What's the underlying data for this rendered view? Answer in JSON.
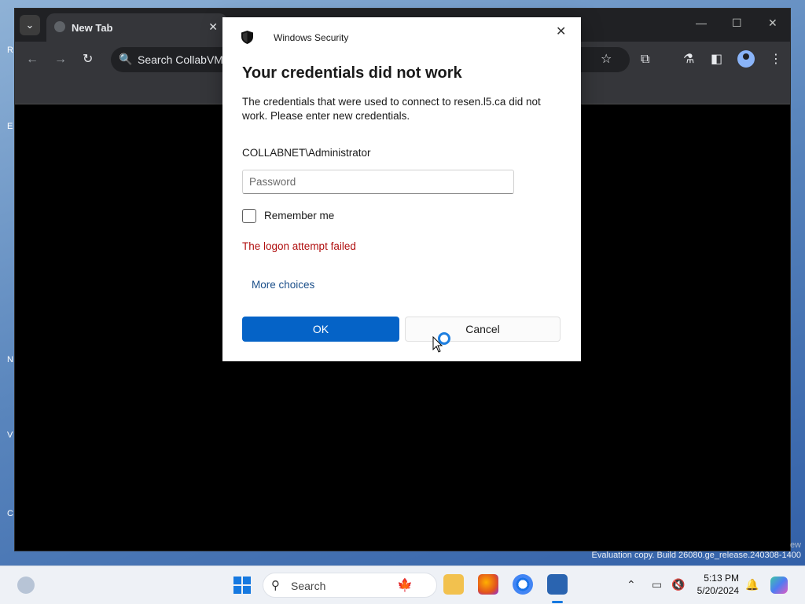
{
  "browser": {
    "tab_title": "New Tab",
    "omnibox_placeholder": "Search CollabVM"
  },
  "dialog": {
    "app_name": "Windows Security",
    "title": "Your credentials did not work",
    "message": "The credentials that were used to connect to resen.l5.ca did not work. Please enter new credentials.",
    "username": "COLLABNET\\Administrator",
    "password_placeholder": "Password",
    "remember_label": "Remember me",
    "remember_checked": false,
    "error_text": "The logon attempt failed",
    "more_choices": "More choices",
    "ok_label": "OK",
    "cancel_label": "Cancel"
  },
  "watermark": {
    "line1": "ew",
    "line2": "Evaluation copy. Build 26080.ge_release.240308-1400"
  },
  "taskbar": {
    "search_label": "Search",
    "time": "5:13 PM",
    "date": "5/20/2024"
  },
  "colors": {
    "accent": "#0563c7",
    "error": "#b00f0f",
    "link": "#1b4f8a"
  }
}
